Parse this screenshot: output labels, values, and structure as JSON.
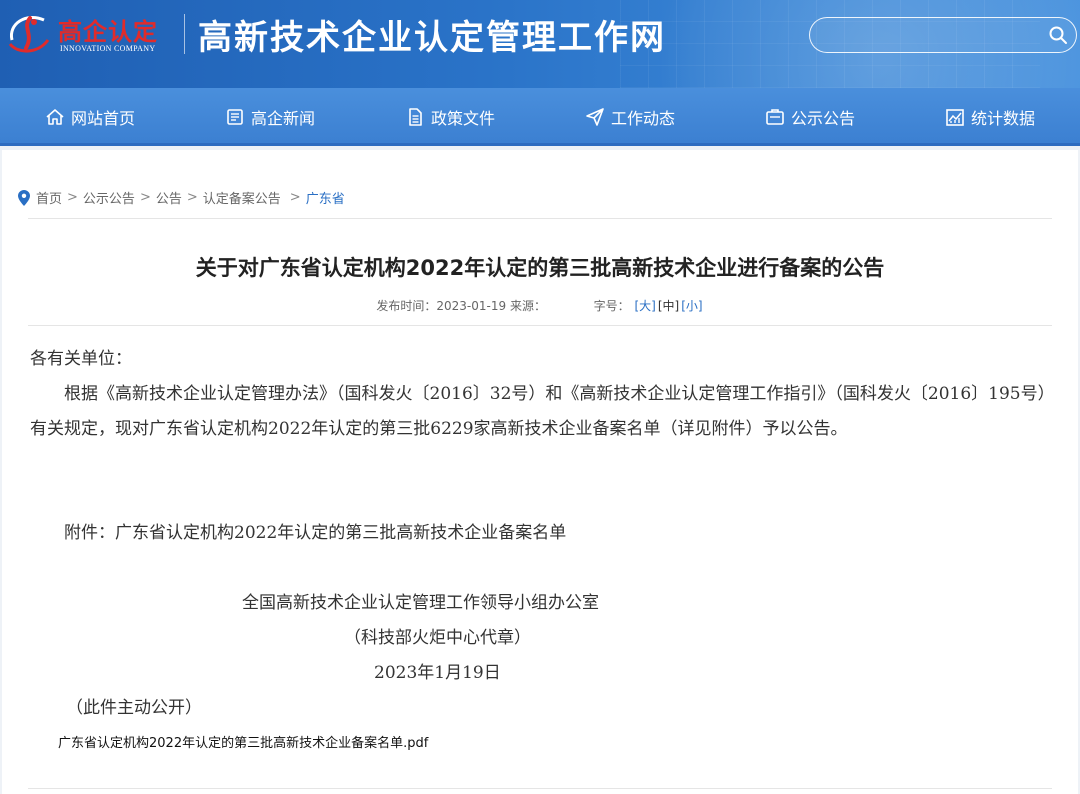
{
  "header": {
    "logo_cn": "高企认定",
    "logo_en": "INNOVATION COMPANY",
    "site_title": "高新技术企业认定管理工作网",
    "search_placeholder": ""
  },
  "nav": {
    "items": [
      {
        "label": "网站首页",
        "icon": "home-icon"
      },
      {
        "label": "高企新闻",
        "icon": "news-icon"
      },
      {
        "label": "政策文件",
        "icon": "document-icon"
      },
      {
        "label": "工作动态",
        "icon": "send-icon"
      },
      {
        "label": "公示公告",
        "icon": "notice-icon"
      },
      {
        "label": "统计数据",
        "icon": "chart-icon"
      }
    ]
  },
  "breadcrumb": {
    "items": [
      "首页",
      "公示公告",
      "公告",
      "认定备案公告",
      "广东省"
    ],
    "separator": ">"
  },
  "article": {
    "title": "关于对广东省认定机构2022年认定的第三批高新技术企业进行备案的公告",
    "meta": {
      "publish_label": "发布时间：",
      "publish_date": "2023-01-19",
      "source_label": "来源：",
      "fontsize_label": "字号：",
      "size_large": "[大]",
      "size_medium": "[中]",
      "size_small": "[小]"
    },
    "greeting": "各有关单位：",
    "paragraph": "根据《高新技术企业认定管理办法》（国科发火〔2016〕32号）和《高新技术企业认定管理工作指引》（国科发火〔2016〕195号）有关规定，现对广东省认定机构2022年认定的第三批6229家高新技术企业备案名单（详见附件）予以公告。",
    "attachment": "附件：广东省认定机构2022年认定的第三批高新技术企业备案名单",
    "signature_org": "全国高新技术企业认定管理工作领导小组办公室",
    "signature_proxy": "（科技部火炬中心代章）",
    "signature_date": "2023年1月19日",
    "public_note": "（此件主动公开）",
    "pdf_link": "广东省认定机构2022年认定的第三批高新技术企业备案名单.pdf"
  },
  "colors": {
    "header_blue": "#2a73c8",
    "nav_blue": "#4a8fdc",
    "link_blue": "#2a6fc4",
    "logo_red": "#e02b2b"
  }
}
